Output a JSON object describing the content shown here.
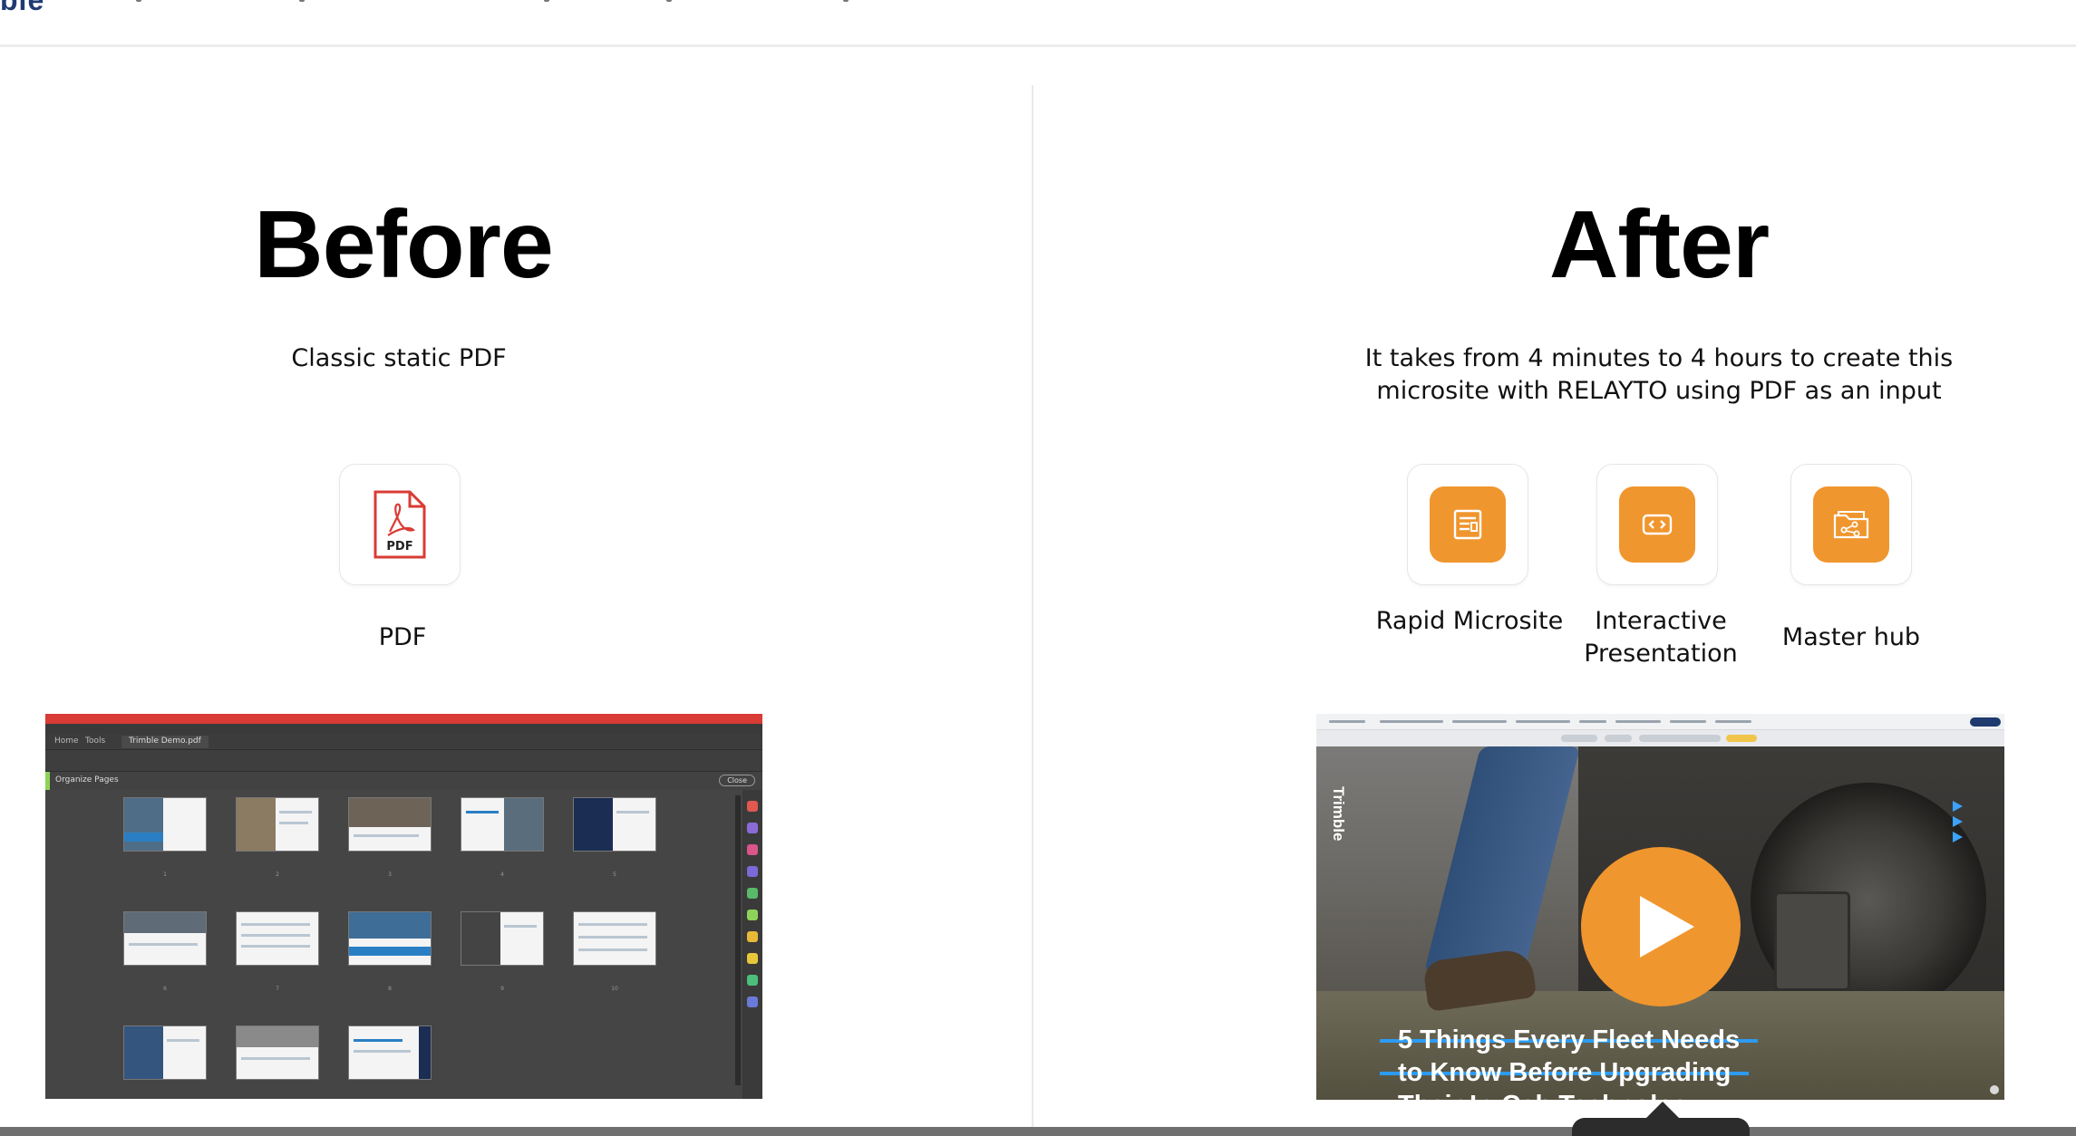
{
  "header": {
    "logo_fragment": "ble"
  },
  "before": {
    "heading": "Before",
    "description": "Classic static PDF",
    "icon_label": "PDF",
    "pdf_icon_text": "PDF",
    "screenshot": {
      "tabs": [
        "Home",
        "Tools",
        "Trimble Demo.pdf"
      ],
      "organize_label": "Organize Pages",
      "close_label": "Close"
    }
  },
  "after": {
    "heading": "After",
    "description": "It takes from 4 minutes to 4 hours to create this microsite with RELAYTO using PDF as an input",
    "icons": [
      {
        "label": "Rapid Microsite",
        "icon": "document-lines-icon"
      },
      {
        "label": "Interactive Presentation",
        "icon": "code-brackets-icon"
      },
      {
        "label": "Master hub",
        "icon": "folder-share-icon"
      }
    ],
    "video": {
      "brand": "Trimble",
      "title_lines": [
        "5 Things Every Fleet Needs",
        "to Know Before Upgrading",
        "Their In-Cab Technology"
      ]
    }
  },
  "colors": {
    "accent_orange": "#f0962e",
    "pdf_red": "#d93b35",
    "title_blue": "#2b9bf2"
  }
}
